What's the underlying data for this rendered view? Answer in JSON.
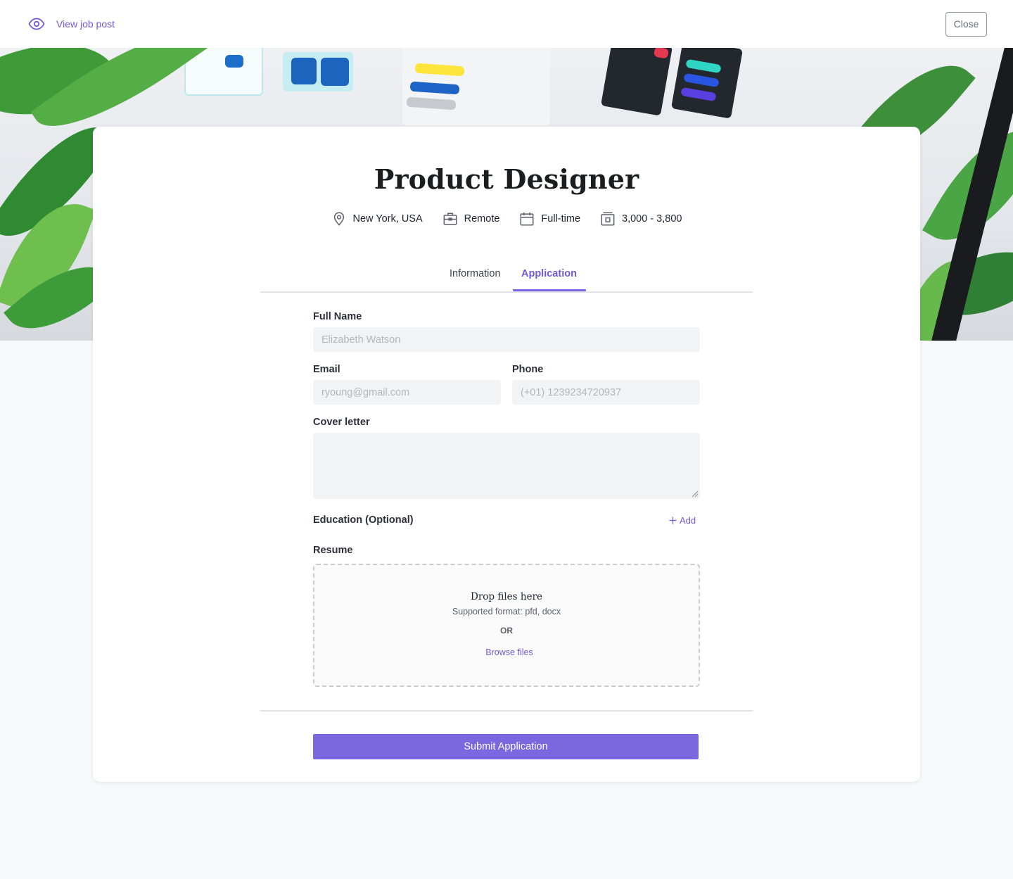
{
  "topbar": {
    "view_job_post": "View job post",
    "close_label": "Close"
  },
  "job": {
    "title": "Product Designer",
    "location": "New York, USA",
    "work_type": "Remote",
    "employment": "Full-time",
    "salary": "3,000 - 3,800"
  },
  "tabs": [
    {
      "label": "Information",
      "active": false
    },
    {
      "label": "Application",
      "active": true
    }
  ],
  "form": {
    "full_name": {
      "label": "Full Name",
      "placeholder": "Elizabeth Watson"
    },
    "email": {
      "label": "Email",
      "placeholder": "ryoung@gmail.com"
    },
    "phone": {
      "label": "Phone",
      "placeholder": "(+01) 1239234720937"
    },
    "cover_letter": {
      "label": "Cover letter",
      "placeholder": ""
    },
    "education": {
      "label": "Education (Optional)",
      "add_label": "Add"
    },
    "resume": {
      "label": "Resume",
      "drop_title": "Drop files here",
      "drop_sub": "Supported format: pfd, docx",
      "or": "OR",
      "browse": "Browse files"
    },
    "submit_label": "Submit Application"
  },
  "icons": {
    "view": "eye-icon",
    "location": "map-pin-icon",
    "work_type": "briefcase-icon",
    "employment": "calendar-icon",
    "salary": "money-icon",
    "add": "plus-icon"
  },
  "colors": {
    "accent": "#7159d6",
    "button": "#7b68e0",
    "page_bg": "#f7f8fa"
  }
}
